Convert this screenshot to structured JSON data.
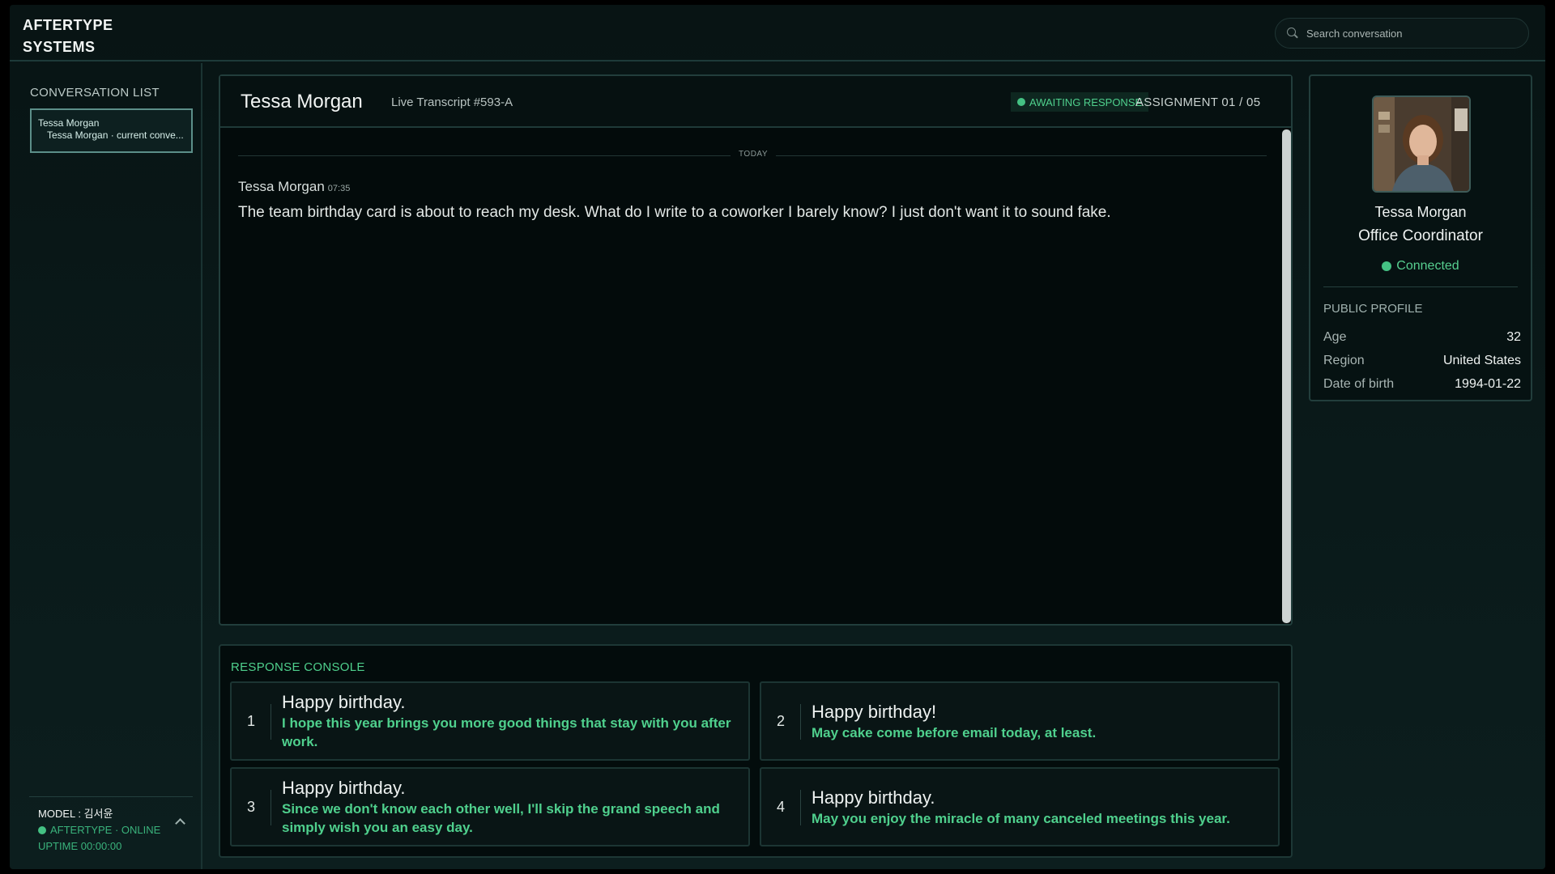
{
  "brand": {
    "line1": "AFTERTYPE",
    "line2": "SYSTEMS"
  },
  "search": {
    "placeholder": "Search conversation"
  },
  "sidebar": {
    "title": "CONVERSATION LIST",
    "items": [
      {
        "name": "Tessa Morgan",
        "subtitle": "Tessa Morgan · current conve..."
      }
    ],
    "model": {
      "label": "MODEL : 김서윤",
      "status": "AFTERTYPE · ONLINE",
      "uptime": "UPTIME 00:00:00"
    }
  },
  "transcript": {
    "name": "Tessa Morgan",
    "transcript_id": "Live Transcript #593-A",
    "status_badge": "AWAITING RESPONSE",
    "assignment": "ASSIGNMENT 01 / 05",
    "day_divider": "TODAY",
    "messages": [
      {
        "author": "Tessa Morgan",
        "time": "07:35",
        "text": "The team birthday card is about to reach my desk. What do I write to a coworker I barely know? I just don't want it to sound fake."
      }
    ]
  },
  "profile": {
    "name": "Tessa Morgan",
    "role": "Office Coordinator",
    "status": "Connected",
    "section_title": "PUBLIC PROFILE",
    "fields": [
      {
        "label": "Age",
        "value": "32"
      },
      {
        "label": "Region",
        "value": "United States"
      },
      {
        "label": "Date of birth",
        "value": "1994-01-22"
      }
    ]
  },
  "console": {
    "title": "RESPONSE CONSOLE",
    "options": [
      {
        "num": "1",
        "head": "Happy birthday.",
        "body": "I hope this year brings you more good things that stay with you after work."
      },
      {
        "num": "2",
        "head": "Happy birthday!",
        "body": "May cake come before email today, at least."
      },
      {
        "num": "3",
        "head": "Happy birthday.",
        "body": "Since we don't know each other well, I'll skip the grand speech and simply wish you an easy day."
      },
      {
        "num": "4",
        "head": "Happy birthday.",
        "body": "May you enjoy the miracle of many canceled meetings this year."
      }
    ]
  },
  "colors": {
    "accent": "#4fd08d",
    "status_online": "#44c183",
    "background": "#081414"
  }
}
